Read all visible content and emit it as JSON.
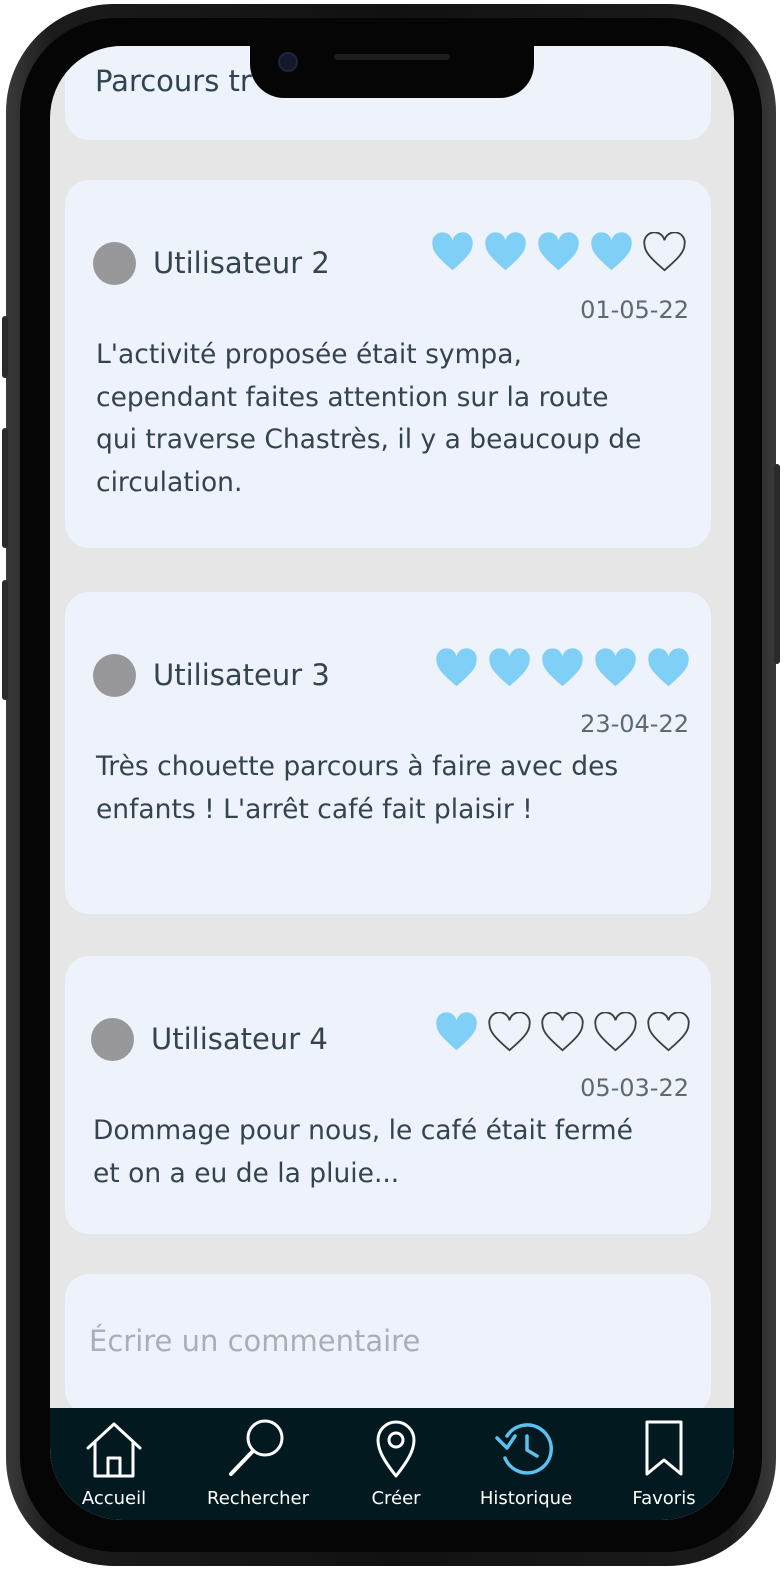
{
  "title_card": {
    "text": "Parcours tr"
  },
  "reviews": [
    {
      "user": "Utilisateur 2",
      "date": "01-05-22",
      "rating": 4,
      "max_rating": 5,
      "text": "L'activité proposée était sympa, cependant faites attention sur la route qui traverse Chastrès, il y a beaucoup de circulation."
    },
    {
      "user": "Utilisateur 3",
      "date": "23-04-22",
      "rating": 5,
      "max_rating": 5,
      "text": "Très chouette parcours à faire avec des enfants ! L'arrêt café fait plaisir !"
    },
    {
      "user": "Utilisateur 4",
      "date": "05-03-22",
      "rating": 1,
      "max_rating": 5,
      "text": "Dommage pour nous, le café était fermé et on a eu de la pluie..."
    }
  ],
  "comment": {
    "placeholder": "Écrire un commentaire"
  },
  "nav": {
    "items": [
      {
        "label": "Accueil",
        "icon": "home-icon"
      },
      {
        "label": "Rechercher",
        "icon": "search-icon"
      },
      {
        "label": "Créer",
        "icon": "map-pin-icon"
      },
      {
        "label": "Historique",
        "icon": "history-icon",
        "active": true
      },
      {
        "label": "Favoris",
        "icon": "bookmark-icon"
      }
    ]
  },
  "colors": {
    "heart_filled": "#7fcff7",
    "heart_outline": "#3e3e3e",
    "nav_background": "#021a1f",
    "nav_active": "#5bc2f0",
    "card_background": "#eef2fb",
    "screen_background": "#e6e6e6"
  }
}
